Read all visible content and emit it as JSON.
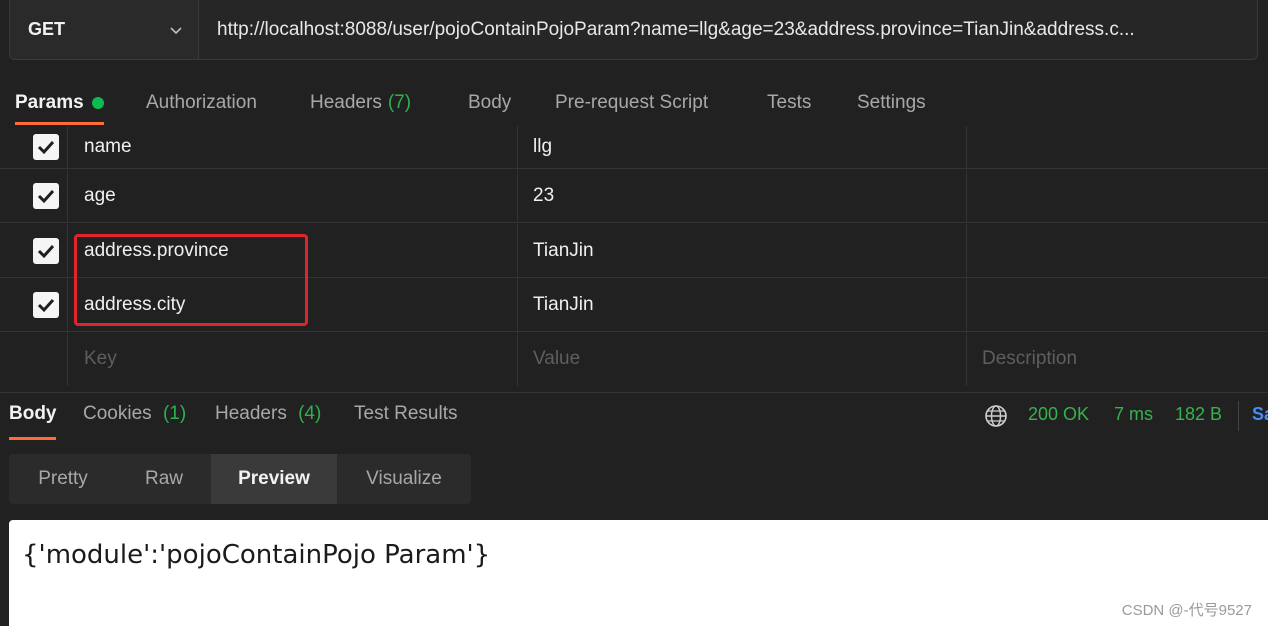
{
  "request": {
    "method": "GET",
    "url": "http://localhost:8088/user/pojoContainPojoParam?name=llg&age=23&address.province=TianJin&address.c..."
  },
  "request_tabs": [
    {
      "label": "Params"
    },
    {
      "label": "Authorization"
    },
    {
      "label": "Headers",
      "count": "(7)"
    },
    {
      "label": "Body"
    },
    {
      "label": "Pre-request Script"
    },
    {
      "label": "Tests"
    },
    {
      "label": "Settings"
    }
  ],
  "params": [
    {
      "checked": true,
      "key": "name",
      "value": "llg",
      "description": ""
    },
    {
      "checked": true,
      "key": "age",
      "value": "23",
      "description": ""
    },
    {
      "checked": true,
      "key": "address.province",
      "value": "TianJin",
      "description": ""
    },
    {
      "checked": true,
      "key": "address.city",
      "value": "TianJin",
      "description": ""
    }
  ],
  "params_placeholders": {
    "key": "Key",
    "value": "Value",
    "description": "Description"
  },
  "response_tabs": [
    {
      "label": "Body"
    },
    {
      "label": "Cookies",
      "count": "(1)"
    },
    {
      "label": "Headers",
      "count": "(4)"
    },
    {
      "label": "Test Results"
    }
  ],
  "response_status": {
    "code": "200 OK",
    "time": "7 ms",
    "size": "182 B",
    "save_peek": "Sa"
  },
  "views": [
    "Pretty",
    "Raw",
    "Preview",
    "Visualize"
  ],
  "active_view": "Preview",
  "preview_body": "{'module':'pojoContainPojo Param'}",
  "watermark": "CSDN @-代号9527",
  "colors": {
    "accent": "#ff6c37",
    "success": "#36b24c",
    "highlight": "#e0242c"
  }
}
